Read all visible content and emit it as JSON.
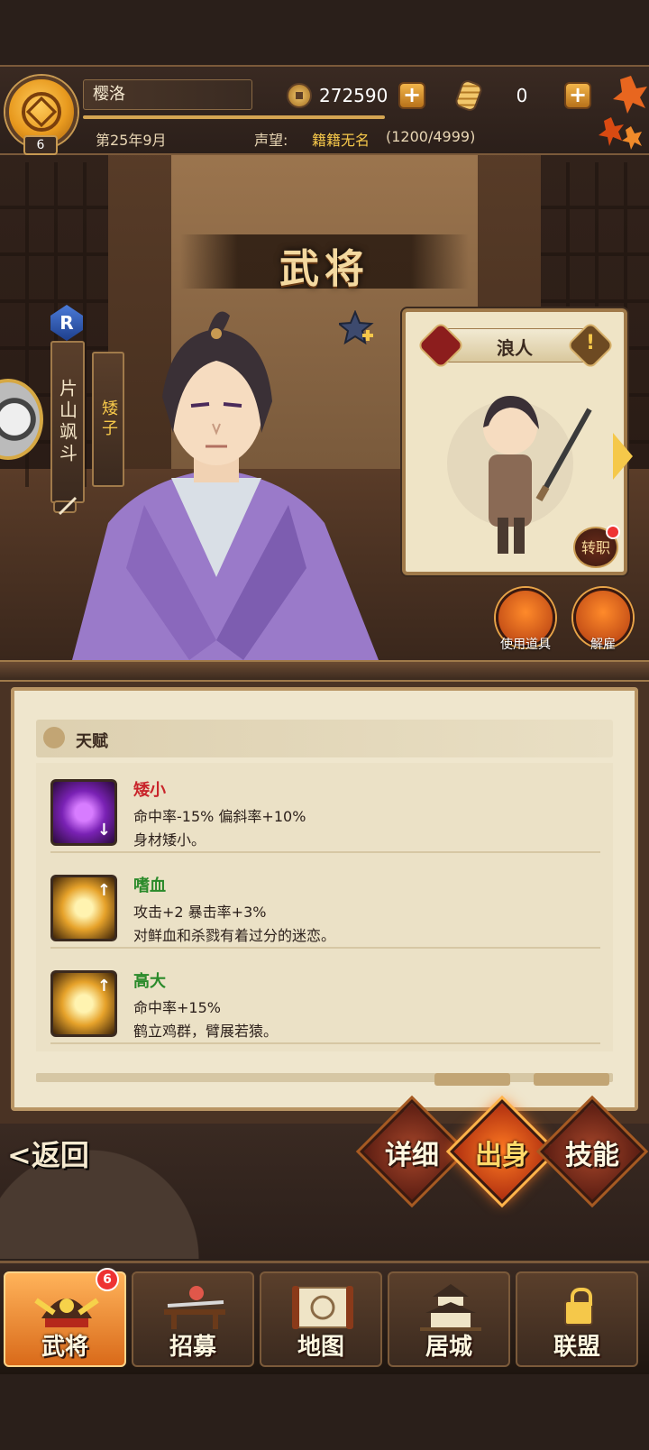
{
  "player": {
    "name": "樱洛",
    "level": "6",
    "date": "第25年9月",
    "reputation_label": "声望:",
    "reputation_value": "籍籍无名",
    "reputation_progress": "(1200/4999)"
  },
  "currency": {
    "coins": "272590",
    "rolls": "0"
  },
  "page": {
    "title": "武将"
  },
  "hero": {
    "rank": "R",
    "name": "片山飒斗",
    "trait": "矮子",
    "class_name": "浪人",
    "transfer_label": "转职"
  },
  "actions": {
    "use_item": "使用道具",
    "dismiss": "解雇"
  },
  "talents": {
    "header": "天赋",
    "items": [
      {
        "name": "矮小",
        "stats": "命中率-15%    偏斜率+10%",
        "desc": "身材矮小。",
        "tier": "negative"
      },
      {
        "name": "嗜血",
        "stats": "攻击+2    暴击率+3%",
        "desc": "对鲜血和杀戮有着过分的迷恋。",
        "tier": "positive"
      },
      {
        "name": "高大",
        "stats": "命中率+15%",
        "desc": "鹤立鸡群，臂展若猿。",
        "tier": "positive"
      }
    ]
  },
  "controls": {
    "back": "<返回",
    "detail": "详细",
    "origin": "出身",
    "skills": "技能"
  },
  "nav": {
    "tabs": [
      {
        "label": "武将",
        "badge": "6",
        "active": true
      },
      {
        "label": "招募"
      },
      {
        "label": "地图"
      },
      {
        "label": "居城"
      },
      {
        "label": "联盟",
        "locked": true
      }
    ]
  },
  "colors": {
    "accent_gold": "#f6c84a",
    "panel_bg": "#efe6cd",
    "negative_red": "#c9252b",
    "positive_green": "#2a8a2a",
    "active_orange": "#ff7a22"
  }
}
